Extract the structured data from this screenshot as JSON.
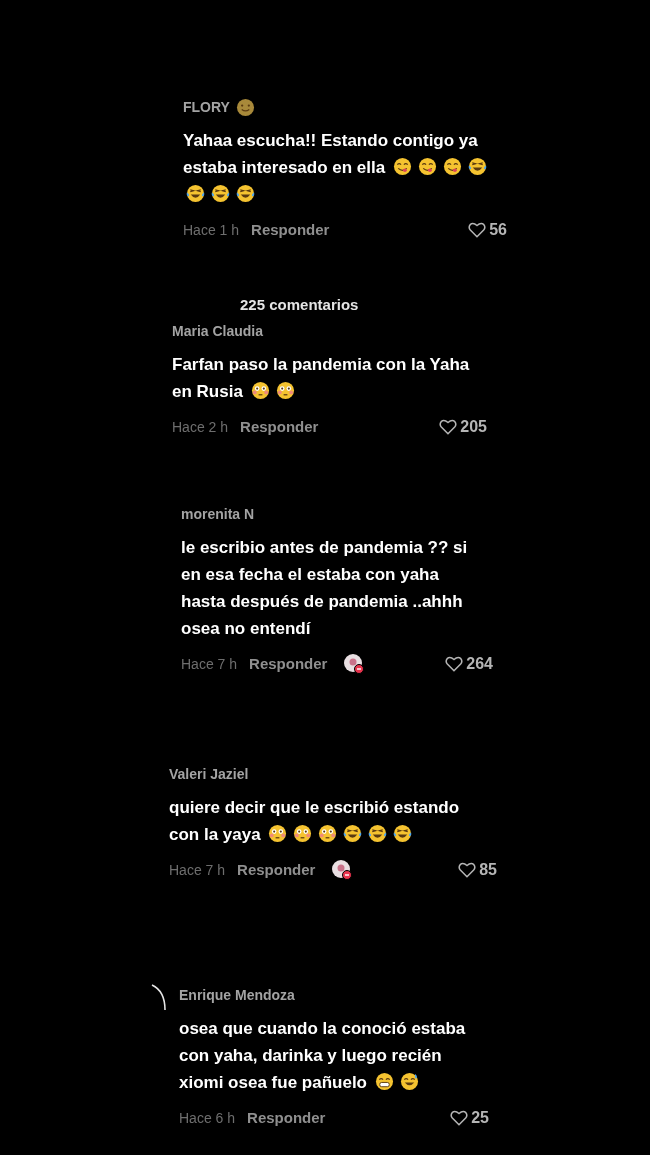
{
  "comments_count": "225 comentarios",
  "comments": [
    {
      "author": "FLORY",
      "author_emojis": [
        {
          "kind": "smile"
        }
      ],
      "text_lines": [
        {
          "text": "Yahaa escucha!! Estando contigo ya"
        },
        {
          "text": "estaba interesado en ella",
          "emojis": [
            {
              "kind": "yum"
            },
            {
              "kind": "yum"
            },
            {
              "kind": "yum"
            },
            {
              "kind": "laugh-cry"
            }
          ]
        },
        {
          "emojis": [
            {
              "kind": "laugh-cry"
            },
            {
              "kind": "laugh-cry"
            },
            {
              "kind": "laugh-cry"
            }
          ]
        }
      ],
      "time": "Hace 1 h",
      "reply": "Responder",
      "likes": "56"
    },
    {
      "author": "Maria Claudia",
      "text_lines": [
        {
          "text": "Farfan paso la pandemia con la Yaha"
        },
        {
          "text": "en Rusia",
          "emojis": [
            {
              "kind": "flushed"
            },
            {
              "kind": "flushed"
            }
          ]
        }
      ],
      "time": "Hace 2 h",
      "reply": "Responder",
      "likes": "205"
    },
    {
      "author": "morenita N",
      "text_lines": [
        {
          "text": "le escribio antes de pandemia ?? si"
        },
        {
          "text": "en esa fecha el estaba con yaha"
        },
        {
          "text": "hasta después de pandemia ..ahhh"
        },
        {
          "text": "osea no entendí"
        }
      ],
      "time": "Hace 7 h",
      "reply": "Responder",
      "sticker": true,
      "likes": "264"
    },
    {
      "author": "Valeri Jaziel",
      "text_lines": [
        {
          "text": "quiere decir que le escribió estando"
        },
        {
          "text": "con la yaya",
          "emojis": [
            {
              "kind": "flushed"
            },
            {
              "kind": "flushed"
            },
            {
              "kind": "flushed"
            },
            {
              "kind": "laugh-cry"
            },
            {
              "kind": "laugh-cry"
            },
            {
              "kind": "laugh-cry"
            }
          ]
        }
      ],
      "time": "Hace 7 h",
      "reply": "Responder",
      "sticker": true,
      "likes": "85"
    },
    {
      "author": "Enrique Mendoza",
      "text_lines": [
        {
          "text": "osea que cuando la conoció estaba"
        },
        {
          "text": "con yaha, darinka y luego recién"
        },
        {
          "text": "xiomi osea fue pañuelo",
          "emojis": [
            {
              "kind": "grin"
            },
            {
              "kind": "sweat-smile"
            }
          ]
        }
      ],
      "time": "Hace 6 h",
      "reply": "Responder",
      "likes": "25"
    }
  ]
}
